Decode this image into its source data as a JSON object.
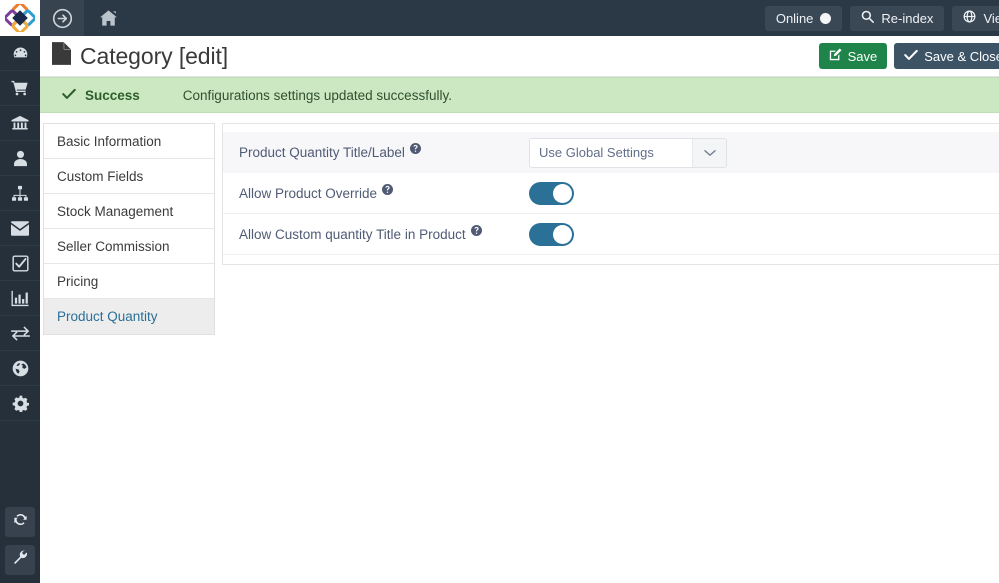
{
  "topbar": {
    "forward_icon": "circle-arrow-right-icon",
    "home_icon": "home-icon",
    "buttons": [
      {
        "label": "Online",
        "icon": "status-dot-icon",
        "name": "online-status-button"
      },
      {
        "label": "Re-index",
        "icon": "search-icon",
        "name": "reindex-button"
      },
      {
        "label": "Vie",
        "icon": "globe-icon",
        "name": "view-store-button"
      }
    ]
  },
  "header": {
    "icon": "file-document-icon",
    "title": "Category [edit]",
    "save_label": "Save",
    "save_icon": "pencil-square-icon",
    "save_close_label": "Save & Close",
    "save_close_icon": "check-icon"
  },
  "alert": {
    "icon": "check-icon",
    "title": "Success",
    "message": "Configurations settings updated successfully."
  },
  "sidebar": {
    "logo": "diamond-logo",
    "items": [
      {
        "name": "sidebar-item-dashboard",
        "icon": "dashboard-icon"
      },
      {
        "name": "sidebar-item-sales",
        "icon": "shopping-cart-icon"
      },
      {
        "name": "sidebar-item-accounting",
        "icon": "bank-icon"
      },
      {
        "name": "sidebar-item-customers",
        "icon": "user-icon"
      },
      {
        "name": "sidebar-item-catalog",
        "icon": "sitemap-icon"
      },
      {
        "name": "sidebar-item-mail",
        "icon": "envelope-icon"
      },
      {
        "name": "sidebar-item-tasks",
        "icon": "check-square-icon"
      },
      {
        "name": "sidebar-item-reports",
        "icon": "bar-chart-icon"
      },
      {
        "name": "sidebar-item-transfers",
        "icon": "exchange-icon"
      },
      {
        "name": "sidebar-item-localization",
        "icon": "globe-icon"
      },
      {
        "name": "sidebar-item-settings",
        "icon": "gear-icon"
      }
    ],
    "bottom_items": [
      {
        "name": "sidebar-refresh-button",
        "icon": "refresh-icon"
      },
      {
        "name": "sidebar-tools-button",
        "icon": "wrench-icon"
      }
    ]
  },
  "navlist": {
    "items": [
      {
        "label": "Basic Information",
        "name": "navlist-item-basic-information",
        "active": false
      },
      {
        "label": "Custom Fields",
        "name": "navlist-item-custom-fields",
        "active": false
      },
      {
        "label": "Stock Management",
        "name": "navlist-item-stock-management",
        "active": false
      },
      {
        "label": "Seller Commission",
        "name": "navlist-item-seller-commission",
        "active": false
      },
      {
        "label": "Pricing",
        "name": "navlist-item-pricing",
        "active": false
      },
      {
        "label": "Product Quantity",
        "name": "navlist-item-product-quantity",
        "active": true
      }
    ]
  },
  "form": {
    "rows": [
      {
        "label": "Product Quantity Title/Label",
        "help_icon": "help-circle-icon",
        "control": "select",
        "value": "Use Global Settings",
        "shaded": true
      },
      {
        "label": "Allow Product Override",
        "help_icon": "help-circle-icon",
        "control": "toggle",
        "value": "on",
        "shaded": false
      },
      {
        "label": "Allow Custom quantity Title in Product",
        "help_icon": "help-circle-icon",
        "control": "toggle",
        "value": "on",
        "shaded": false
      }
    ]
  },
  "colors": {
    "rail": "#25303b",
    "topbar": "#2b3845",
    "accent_green": "#1e8449",
    "accent_toggle": "#2b7197",
    "active_link": "#2a6f97",
    "alert_bg": "#cbe8c3"
  }
}
